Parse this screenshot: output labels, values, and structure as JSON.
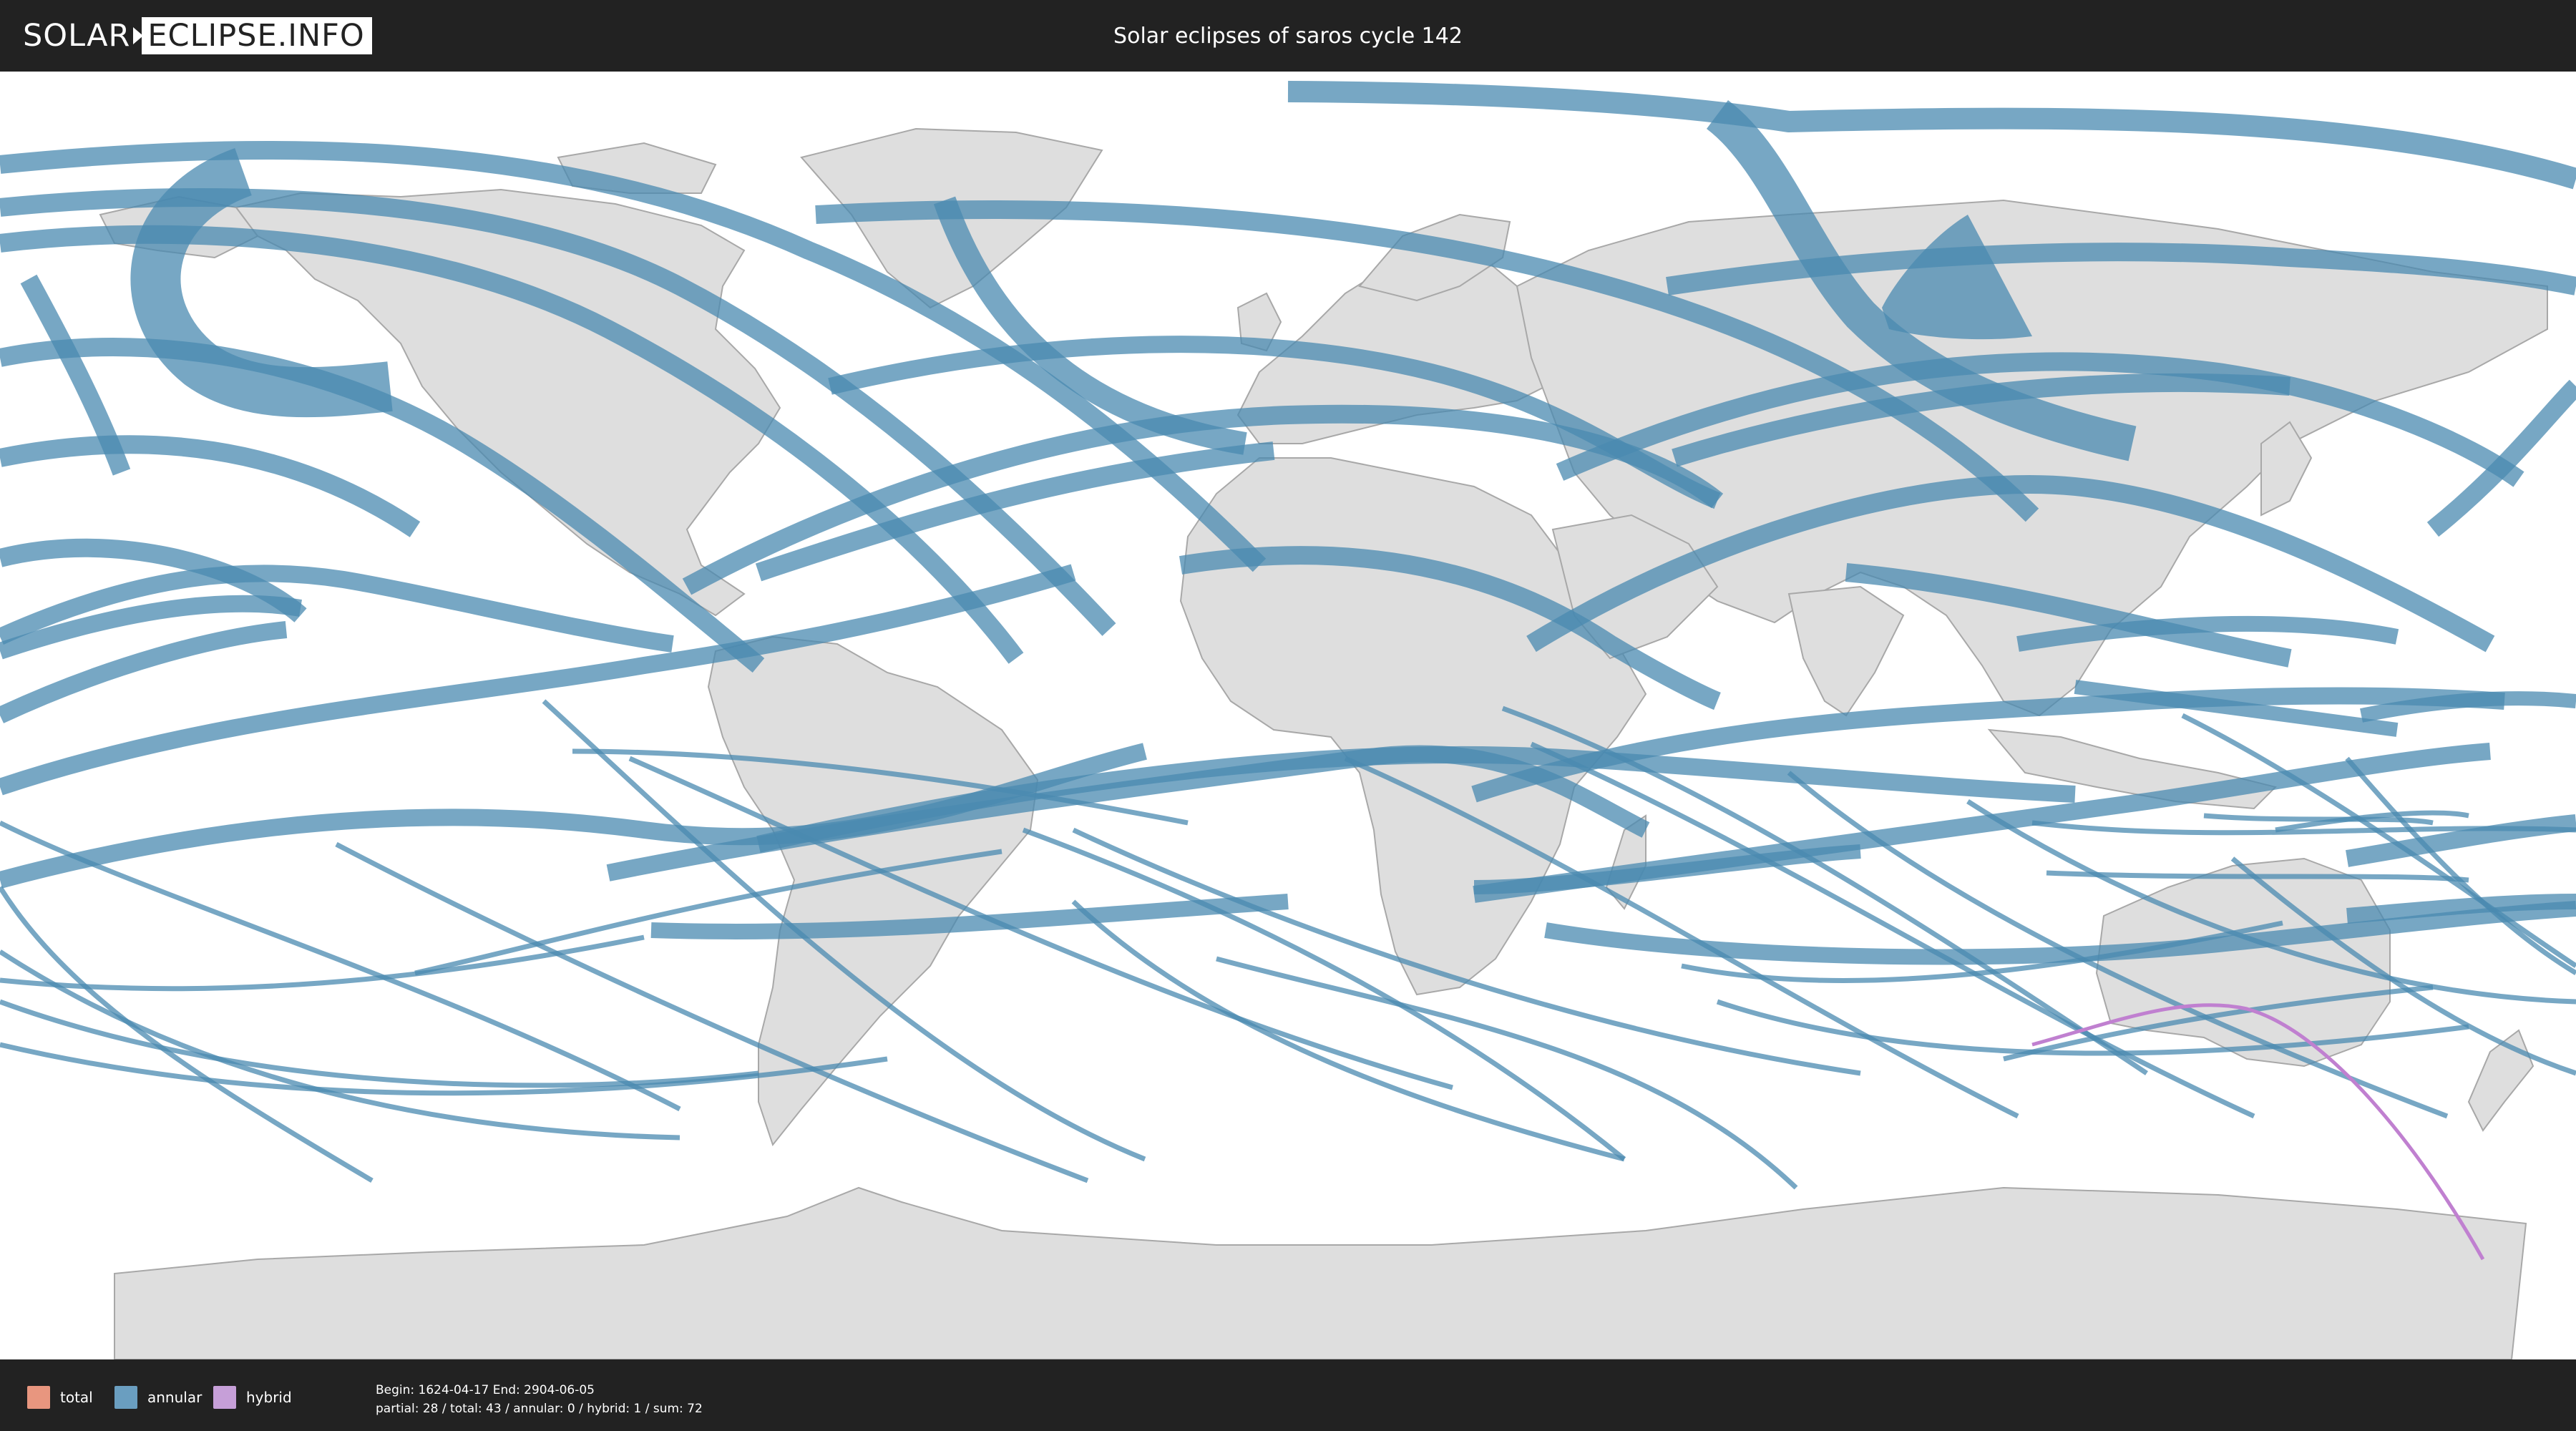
{
  "header": {
    "logo_left": "SOLAR",
    "logo_right": "ECLIPSE.INFO",
    "title": "Solar eclipses of saros cycle 142"
  },
  "legend": [
    {
      "label": "total",
      "color": "#e8967f"
    },
    {
      "label": "annular",
      "color": "#6a9ec0"
    },
    {
      "label": "hybrid",
      "color": "#c69fd8"
    }
  ],
  "info": {
    "line1": "Begin: 1624-04-17 End: 2904-06-05",
    "line2": "partial: 28 / total: 43 / annular: 0 / hybrid: 1 / sum: 72"
  },
  "colors": {
    "bar": "#222222",
    "land": "#dedede",
    "ocean": "#ffffff",
    "annular": "#4a89b0",
    "hybrid": "#c080d0"
  }
}
